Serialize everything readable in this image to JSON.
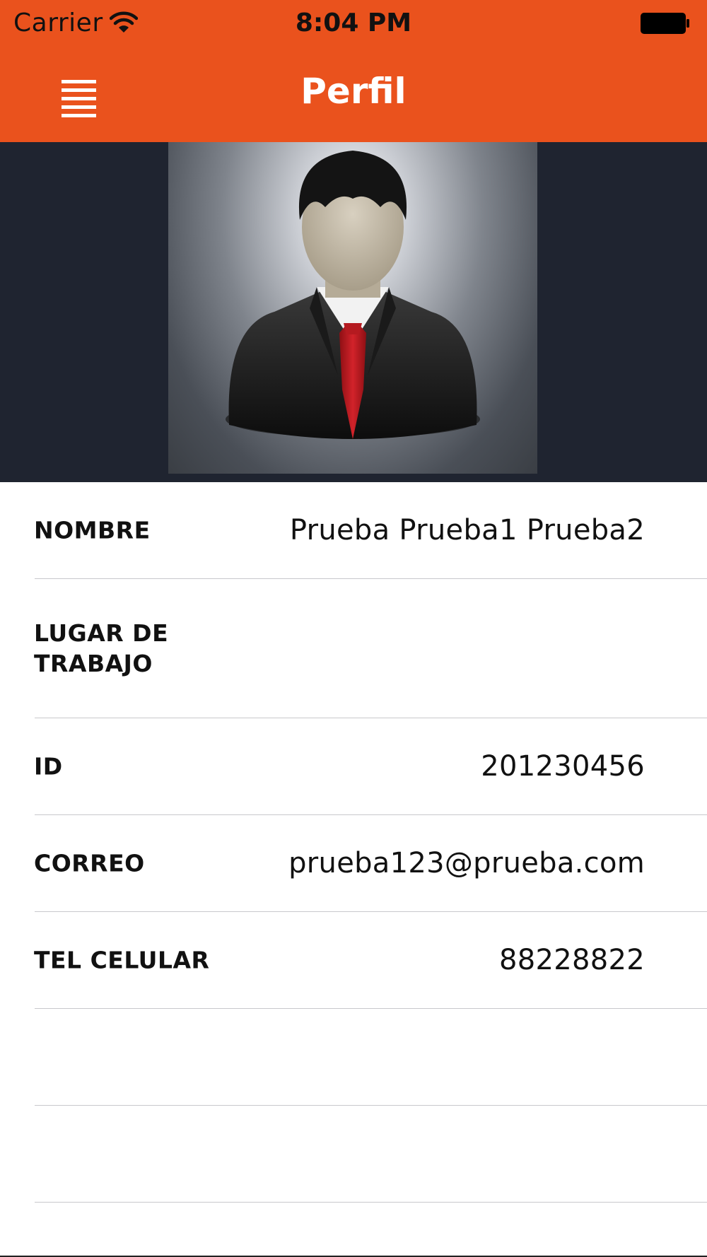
{
  "status_bar": {
    "carrier": "Carrier",
    "time": "8:04 PM",
    "icons": [
      "wifi-icon",
      "battery-icon"
    ]
  },
  "nav_bar": {
    "title": "Perfil",
    "menu_icon": "hamburger-menu-icon",
    "background_color": "#ea521d"
  },
  "profile": {
    "avatar_icon": "businessman-avatar-icon",
    "hero_background_color": "#1f2430"
  },
  "fields": [
    {
      "label": "NOMBRE",
      "value": "Prueba Prueba1 Prueba2"
    },
    {
      "label": "LUGAR DE TRABAJO",
      "value": ""
    },
    {
      "label": "ID",
      "value": "201230456"
    },
    {
      "label": "CORREO",
      "value": "prueba123@prueba.com"
    },
    {
      "label": "TEL CELULAR",
      "value": "88228822"
    },
    {
      "label": "",
      "value": ""
    },
    {
      "label": "",
      "value": ""
    }
  ]
}
